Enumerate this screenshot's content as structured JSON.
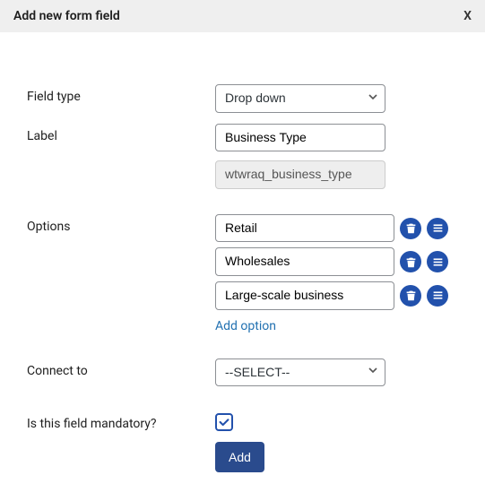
{
  "header": {
    "title": "Add new form field",
    "close_label": "X"
  },
  "fields": {
    "field_type": {
      "label": "Field type",
      "value": "Drop down"
    },
    "label": {
      "label": "Label",
      "value": "Business Type",
      "slug": "wtwraq_business_type"
    },
    "options": {
      "label": "Options",
      "items": [
        "Retail",
        "Wholesales",
        "Large-scale business"
      ],
      "add_link": "Add option"
    },
    "connect_to": {
      "label": "Connect to",
      "value": "--SELECT--"
    },
    "mandatory": {
      "label": "Is this field mandatory?",
      "checked": true
    }
  },
  "submit_label": "Add"
}
